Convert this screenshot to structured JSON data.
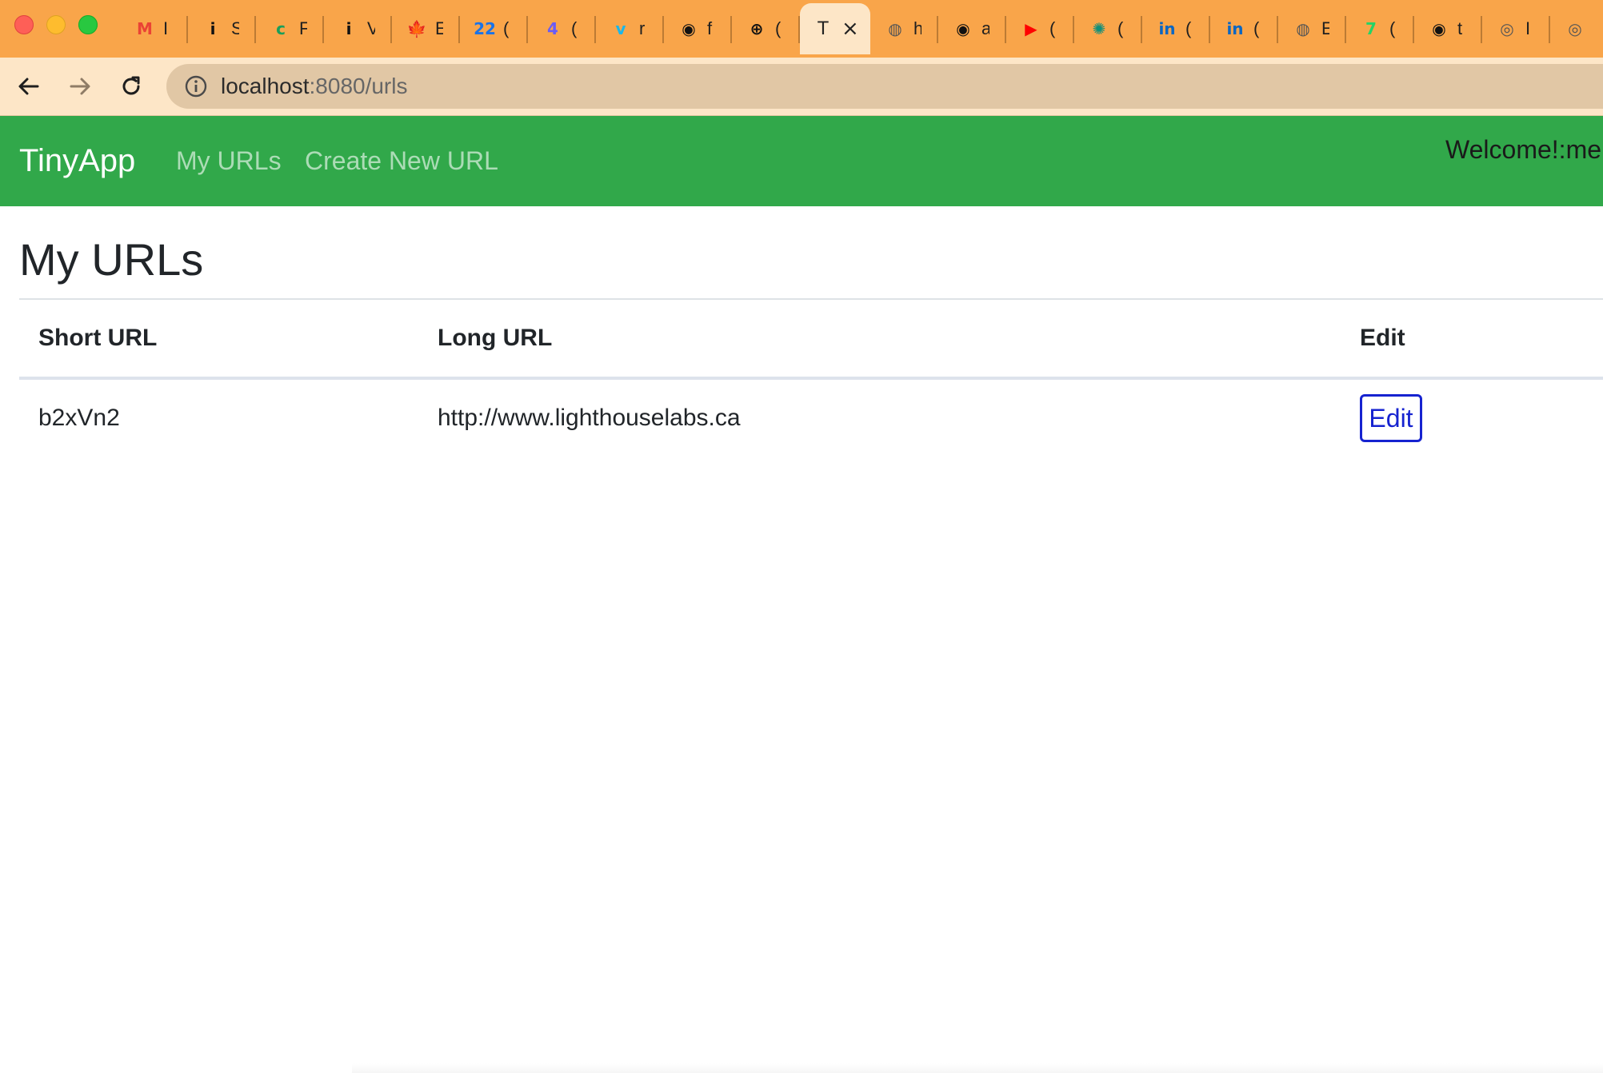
{
  "browser": {
    "tabs": [
      {
        "icon": "gmail-icon",
        "glyph": "M",
        "label": "I",
        "color": "#ea4335"
      },
      {
        "icon": "info-icon",
        "glyph": "i",
        "label": "S",
        "color": "#111111"
      },
      {
        "icon": "chat-icon",
        "glyph": "c",
        "label": "F",
        "color": "#1a9e5a"
      },
      {
        "icon": "info-icon",
        "glyph": "i",
        "label": "V",
        "color": "#111111"
      },
      {
        "icon": "maple-leaf-icon",
        "glyph": "🍁",
        "label": "E",
        "color": "#d52b1e"
      },
      {
        "icon": "calendar-icon",
        "glyph": "22",
        "label": "(",
        "color": "#1a73e8"
      },
      {
        "icon": "messenger-icon",
        "glyph": "4",
        "label": "(",
        "color": "#6a5cf5"
      },
      {
        "icon": "vimeo-icon",
        "glyph": "v",
        "label": "r",
        "color": "#1ab7ea"
      },
      {
        "icon": "github-icon",
        "glyph": "◉",
        "label": "f",
        "color": "#111111"
      },
      {
        "icon": "compass-icon",
        "glyph": "⊕",
        "label": "(",
        "color": "#111111"
      },
      {
        "icon": "",
        "glyph": "T",
        "label": "",
        "color": "#222222",
        "active": true
      },
      {
        "icon": "globe-icon",
        "glyph": "◍",
        "label": "h",
        "color": "#555555"
      },
      {
        "icon": "github-icon",
        "glyph": "◉",
        "label": "a",
        "color": "#111111"
      },
      {
        "icon": "youtube-icon",
        "glyph": "▶",
        "label": "(",
        "color": "#ff0000"
      },
      {
        "icon": "openai-icon",
        "glyph": "✺",
        "label": "(",
        "color": "#0f8f7a"
      },
      {
        "icon": "linkedin-icon",
        "glyph": "in",
        "label": "(",
        "color": "#0a66c2"
      },
      {
        "icon": "linkedin-icon",
        "glyph": "in",
        "label": "(",
        "color": "#0a66c2"
      },
      {
        "icon": "globe-icon",
        "glyph": "◍",
        "label": "E",
        "color": "#555555"
      },
      {
        "icon": "whatsapp-icon",
        "glyph": "7",
        "label": "(",
        "color": "#25d366"
      },
      {
        "icon": "github-icon",
        "glyph": "◉",
        "label": "t",
        "color": "#111111"
      },
      {
        "icon": "chrome-icon",
        "glyph": "◎",
        "label": "I",
        "color": "#555555"
      },
      {
        "icon": "chrome-icon",
        "glyph": "◎",
        "label": "",
        "color": "#555555"
      }
    ],
    "url_host": "localhost",
    "url_path": ":8080/urls"
  },
  "navbar": {
    "brand": "TinyApp",
    "links": [
      "My URLs",
      "Create New URL"
    ],
    "welcome": "Welcome!:me"
  },
  "main": {
    "title": "My URLs",
    "columns": [
      "Short URL",
      "Long URL",
      "Edit"
    ],
    "rows": [
      {
        "short_url": "b2xVn2",
        "long_url": "http://www.lighthouselabs.ca",
        "action": "Edit"
      }
    ]
  },
  "colors": {
    "tabstrip": "#f9a54a",
    "toolbar": "#fde6c7",
    "navbar": "#31a84a",
    "edit_button": "#1623d0"
  }
}
